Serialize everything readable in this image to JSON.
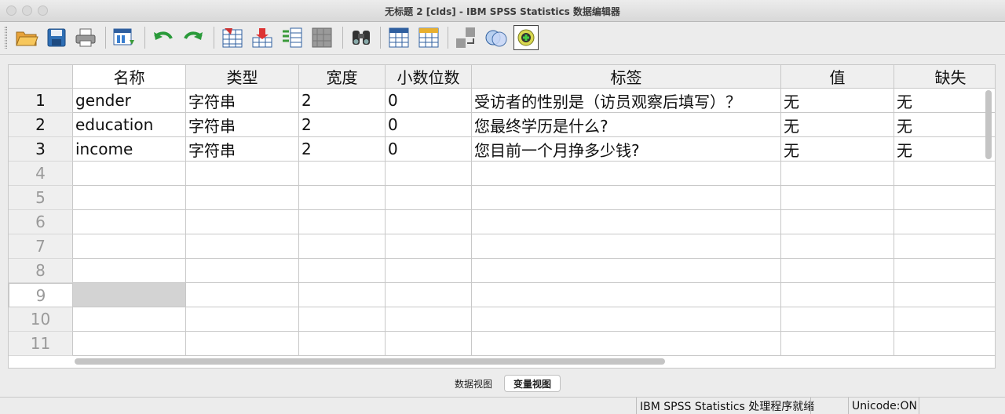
{
  "window": {
    "title": "无标题 2 [clds] - IBM SPSS Statistics 数据编辑器"
  },
  "toolbar": {
    "icons": [
      "open-folder-icon",
      "save-icon",
      "print-icon",
      "dialog-recall-icon",
      "undo-icon",
      "redo-icon",
      "goto-case-icon",
      "goto-variable-icon",
      "variables-icon",
      "run-descriptives-icon",
      "find-icon",
      "insert-cases-icon",
      "insert-variable-icon",
      "split-file-icon",
      "weight-cases-icon",
      "select-cases-icon",
      "value-labels-icon"
    ]
  },
  "grid": {
    "columns": [
      "名称",
      "类型",
      "宽度",
      "小数位数",
      "标签",
      "值",
      "缺失"
    ],
    "rows": [
      {
        "num": "1",
        "cells": [
          "gender",
          "字符串",
          "2",
          "0",
          "受访者的性别是（访员观察后填写）？",
          "无",
          "无"
        ]
      },
      {
        "num": "2",
        "cells": [
          "education",
          "字符串",
          "2",
          "0",
          "您最终学历是什么?",
          "无",
          "无"
        ]
      },
      {
        "num": "3",
        "cells": [
          "income",
          "字符串",
          "2",
          "0",
          "您目前一个月挣多少钱?",
          "无",
          "无"
        ]
      }
    ],
    "empty_rows": [
      "4",
      "5",
      "6",
      "7",
      "8",
      "9",
      "10",
      "11"
    ]
  },
  "tabs": {
    "data_view": "数据视图",
    "variable_view": "变量视图"
  },
  "status": {
    "processor": "IBM SPSS Statistics 处理程序就绪",
    "unicode": "Unicode:ON"
  }
}
